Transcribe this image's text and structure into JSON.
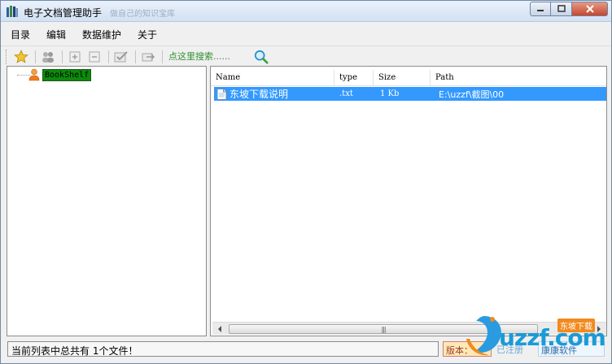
{
  "window": {
    "title": "电子文档管理助手",
    "title_faded": "做自己的知识宝库"
  },
  "menu": {
    "items": [
      "目录",
      "编辑",
      "数据维护",
      "关于"
    ]
  },
  "toolbar": {
    "icons": [
      "star-icon",
      "users-icon",
      "plus-icon",
      "minus-icon",
      "check-icon",
      "move-icon",
      "search-icon"
    ],
    "search_placeholder": "点这里搜索......"
  },
  "tree": {
    "root_label": "BookShelf"
  },
  "table": {
    "columns": [
      "Name",
      "type",
      "Size",
      "Path"
    ],
    "rows": [
      {
        "name": "东坡下载说明",
        "type": ".txt",
        "size": "1 Kb",
        "path": "E:\\uzzf\\截图\\00"
      }
    ]
  },
  "status": {
    "message": "当前列表中总共有 1个文件！",
    "version_label": "版本：",
    "register_label": "已注册",
    "publisher": "康康软件"
  },
  "watermark": {
    "text": "uzzf.com",
    "badge": "东坡下载"
  },
  "colors": {
    "selection": "#3399ff",
    "tree_highlight": "#0b8a0b",
    "search_text": "#2f8f2f"
  }
}
